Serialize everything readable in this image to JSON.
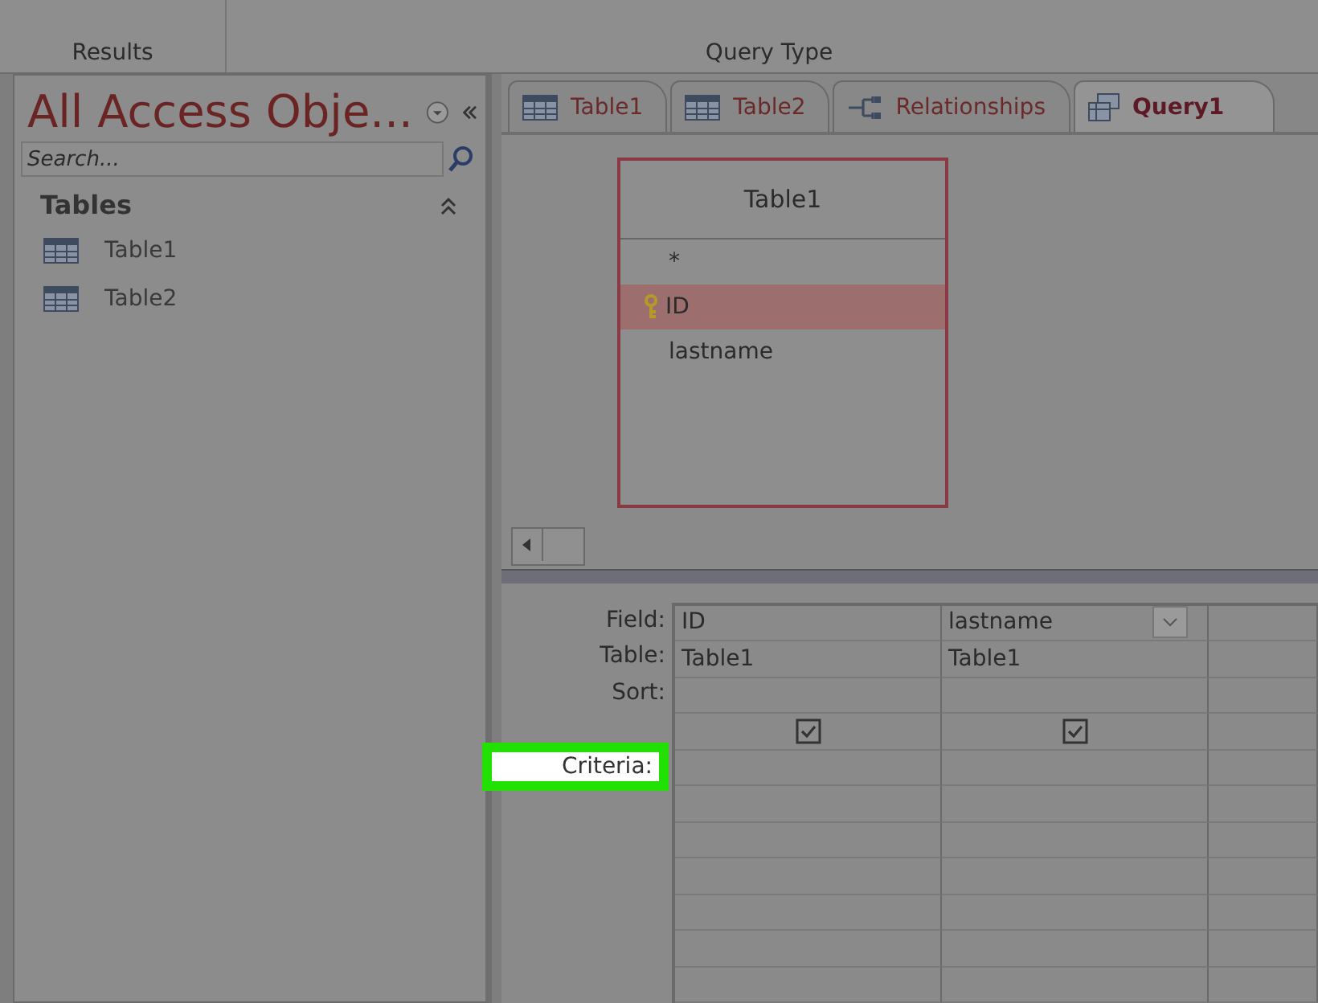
{
  "ribbon": {
    "groups": [
      "Results",
      "Query Type"
    ]
  },
  "navigation_pane": {
    "title": "All Access Obje...",
    "search": {
      "placeholder": "Search..."
    },
    "section": {
      "label": "Tables",
      "expanded": true
    },
    "items": [
      {
        "label": "Table1"
      },
      {
        "label": "Table2"
      }
    ]
  },
  "tabs": [
    {
      "label": "Table1",
      "kind": "table",
      "selected": false
    },
    {
      "label": "Table2",
      "kind": "table",
      "selected": false
    },
    {
      "label": "Relationships",
      "kind": "relationships",
      "selected": false
    },
    {
      "label": "Query1",
      "kind": "query",
      "selected": true
    }
  ],
  "table_box": {
    "title": "Table1",
    "fields": [
      {
        "name": "*",
        "primary_key": false,
        "selected": false
      },
      {
        "name": "ID",
        "primary_key": true,
        "selected": true
      },
      {
        "name": "lastname",
        "primary_key": false,
        "selected": false
      }
    ]
  },
  "design_grid": {
    "rows": [
      {
        "kind": "field",
        "label": "Field:"
      },
      {
        "kind": "table",
        "label": "Table:"
      },
      {
        "kind": "sort",
        "label": "Sort:"
      },
      {
        "kind": "show"
      },
      {
        "kind": "criteria",
        "label": "Criteria:",
        "highlighted": true
      },
      {
        "kind": "or"
      },
      {
        "kind": "blank"
      },
      {
        "kind": "blank"
      },
      {
        "kind": "blank"
      },
      {
        "kind": "blank"
      },
      {
        "kind": "blank"
      }
    ],
    "columns": [
      {
        "field": "ID",
        "table": "Table1",
        "show": true,
        "dropdown": false
      },
      {
        "field": "lastname",
        "table": "Table1",
        "show": true,
        "dropdown": true
      }
    ]
  }
}
